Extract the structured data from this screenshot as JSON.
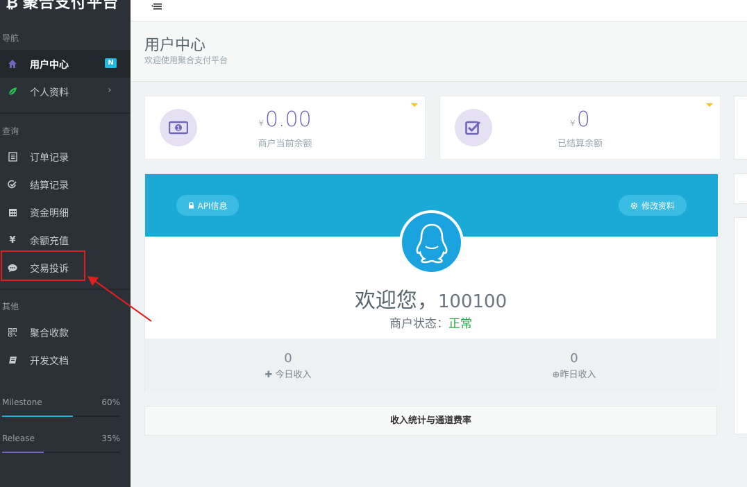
{
  "brand": {
    "title": "聚合支付平台",
    "glyph": "₿"
  },
  "sidebar": {
    "sections": {
      "nav": "导航",
      "query": "查询",
      "other": "其他"
    },
    "items": [
      {
        "label": "用户中心",
        "icon": "home-icon",
        "badge": "N"
      },
      {
        "label": "个人资料",
        "icon": "leaf-icon"
      },
      {
        "label": "订单记录",
        "icon": "list-icon"
      },
      {
        "label": "结算记录",
        "icon": "check-icon"
      },
      {
        "label": "资金明细",
        "icon": "calendar-icon"
      },
      {
        "label": "余额充值",
        "icon": "yen-icon"
      },
      {
        "label": "交易投诉",
        "icon": "comment-icon"
      },
      {
        "label": "聚合收款",
        "icon": "qrcode-icon"
      },
      {
        "label": "开发文档",
        "icon": "book-icon"
      }
    ],
    "progress": [
      {
        "label": "Milestone",
        "value_text": "60%",
        "value": 0.6,
        "color": "#23b7e5"
      },
      {
        "label": "Release",
        "value_text": "35%",
        "value": 0.35,
        "color": "#7266ba"
      }
    ]
  },
  "header": {
    "title": "用户中心",
    "subtitle": "欢迎使用聚合支付平台"
  },
  "stats": [
    {
      "currency": "¥",
      "value": "0.00",
      "label": "商户当前余额",
      "icon": "money-icon"
    },
    {
      "currency": "¥",
      "value": "0",
      "label": "已结算余额",
      "icon": "check-square-icon"
    }
  ],
  "profile": {
    "api_button": "API信息",
    "edit_button": "修改资料",
    "welcome_prefix": "欢迎您，",
    "user_id": "100100",
    "status_label": "商户状态：",
    "status_value": "正常",
    "today_income": {
      "value": "0",
      "label": "今日收入"
    },
    "yesterday_income": {
      "value": "0",
      "label": "昨日收入"
    }
  },
  "income_bar": {
    "label": "收入统计与通道费率"
  },
  "colors": {
    "sidebar_bg": "#2b3136",
    "accent": "#23b7e5",
    "purple": "#7266ba",
    "profile_blue": "#1ba9d6",
    "status_ok": "#27a744",
    "annotation_red": "#e02020"
  }
}
